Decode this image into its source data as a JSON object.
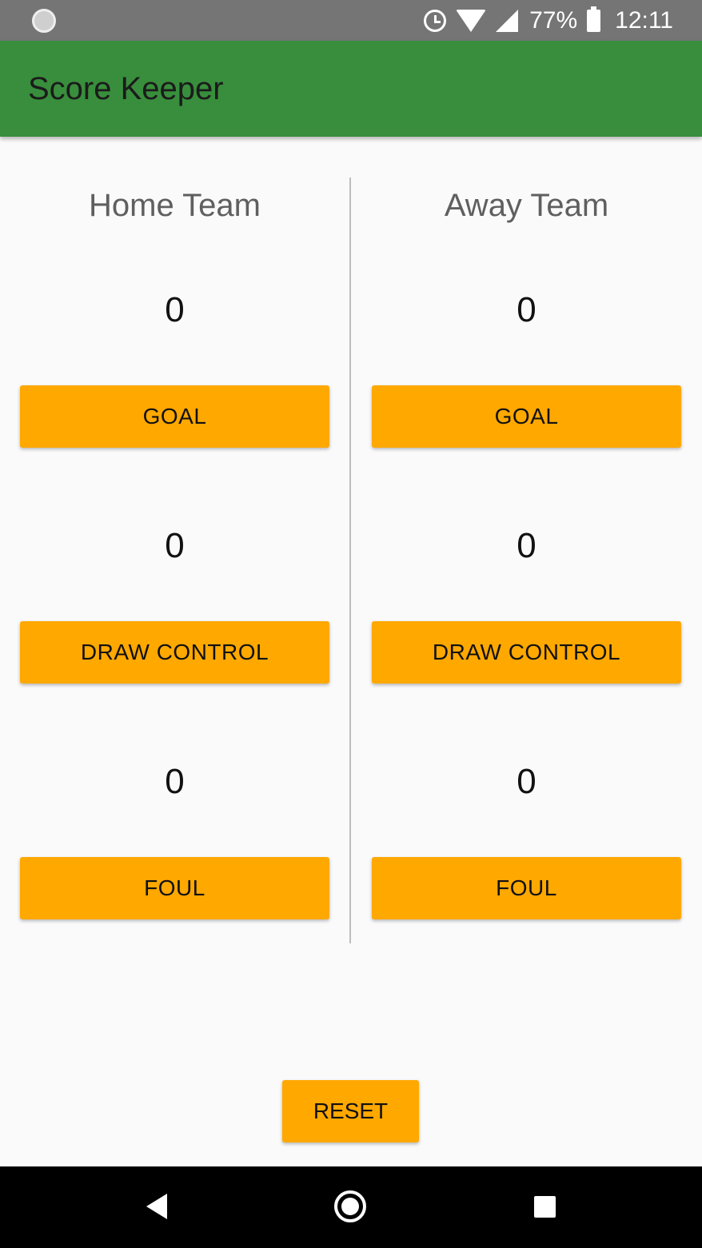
{
  "status_bar": {
    "battery": "77%",
    "time": "12:11",
    "icons": [
      "sync-icon",
      "alarm-icon",
      "wifi-icon",
      "cell-signal-icon",
      "battery-charging-icon"
    ]
  },
  "app_bar": {
    "title": "Score Keeper",
    "color": "#388e3c"
  },
  "home": {
    "team_name": "Home Team",
    "goals": "0",
    "goal_button": "GOAL",
    "draw_controls": "0",
    "draw_control_button": "DRAW CONTROL",
    "fouls": "0",
    "foul_button": "FOUL"
  },
  "away": {
    "team_name": "Away Team",
    "goals": "0",
    "goal_button": "GOAL",
    "draw_controls": "0",
    "draw_control_button": "DRAW CONTROL",
    "fouls": "0",
    "foul_button": "FOUL"
  },
  "reset_button": "RESET",
  "colors": {
    "accent": "#ffa800",
    "status_bar": "#757575",
    "nav_bar": "#000000"
  },
  "nav_bar": {
    "icons": [
      "back-icon",
      "home-icon",
      "recents-icon"
    ]
  }
}
